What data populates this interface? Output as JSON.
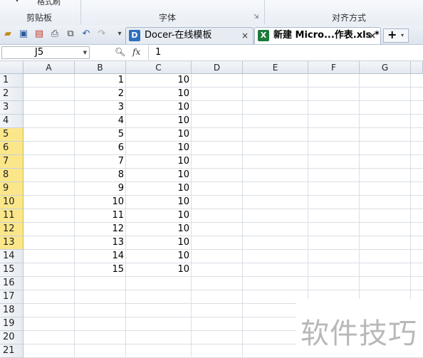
{
  "ribbon": {
    "format_painter": "格式刷",
    "groups": [
      {
        "label": "剪贴板"
      },
      {
        "label": "字体"
      },
      {
        "label": "对齐方式"
      }
    ]
  },
  "tabs": [
    {
      "label": "Docer-在线模板",
      "close": "×",
      "icon": "D",
      "active": false
    },
    {
      "label": "新建 Micro...作表.xls *",
      "close": "×",
      "icon": "X",
      "active": true
    }
  ],
  "add_tab": {
    "plus": "+",
    "dropdown": "▾"
  },
  "formula_bar": {
    "name_box": "J5",
    "fx": "fx",
    "value": "1"
  },
  "columns": [
    "A",
    "B",
    "C",
    "D",
    "E",
    "F",
    "G"
  ],
  "rows": [
    "1",
    "2",
    "3",
    "4",
    "5",
    "6",
    "7",
    "8",
    "9",
    "10",
    "11",
    "12",
    "13",
    "14",
    "15",
    "16",
    "17",
    "18",
    "19",
    "20",
    "21"
  ],
  "selected_rows": [
    5,
    6,
    7,
    8,
    9,
    10,
    11,
    12,
    13
  ],
  "cells": {
    "B": [
      "1",
      "2",
      "3",
      "4",
      "5",
      "6",
      "7",
      "8",
      "9",
      "10",
      "11",
      "12",
      "13",
      "14",
      "15"
    ],
    "C": [
      "10",
      "10",
      "10",
      "10",
      "10",
      "10",
      "10",
      "10",
      "10",
      "10",
      "10",
      "10",
      "10",
      "10",
      "10"
    ]
  },
  "watermark": "软件技巧",
  "colors": {
    "selected_row_header": "#fbe78a",
    "grid": "#d9dee5",
    "tab_active": "#ffffff",
    "excel_icon": "#1d7a3b",
    "docer_icon": "#2d6fbf"
  }
}
